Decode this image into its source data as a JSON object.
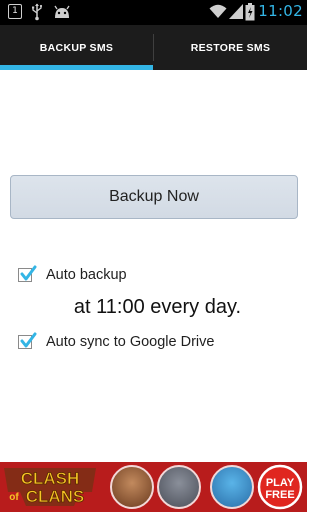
{
  "status_bar": {
    "notification_count": "1",
    "time": "11:02",
    "icons": [
      "notification-icon",
      "usb-icon",
      "android-debug-icon",
      "wifi-icon",
      "signal-icon",
      "battery-icon"
    ]
  },
  "tabs": [
    {
      "label": "BACKUP SMS",
      "selected": true
    },
    {
      "label": "RESTORE SMS",
      "selected": false
    }
  ],
  "main": {
    "backup_button_label": "Backup Now",
    "auto_backup": {
      "label": "Auto backup",
      "checked": true
    },
    "schedule_text": "at 11:00 every day.",
    "auto_sync": {
      "label": "Auto sync to Google Drive",
      "checked": true
    }
  },
  "ad": {
    "logo_line1": "CLASH",
    "logo_line2": "of",
    "logo_line3": "CLANS",
    "cta_line1": "PLAY",
    "cta_line2": "FREE",
    "background": "#b81c1c"
  },
  "colors": {
    "accent": "#33b5e5",
    "checkbox": "#33b5e5",
    "tab_bar": "#1c1c1c",
    "status_bar": "#000000"
  }
}
